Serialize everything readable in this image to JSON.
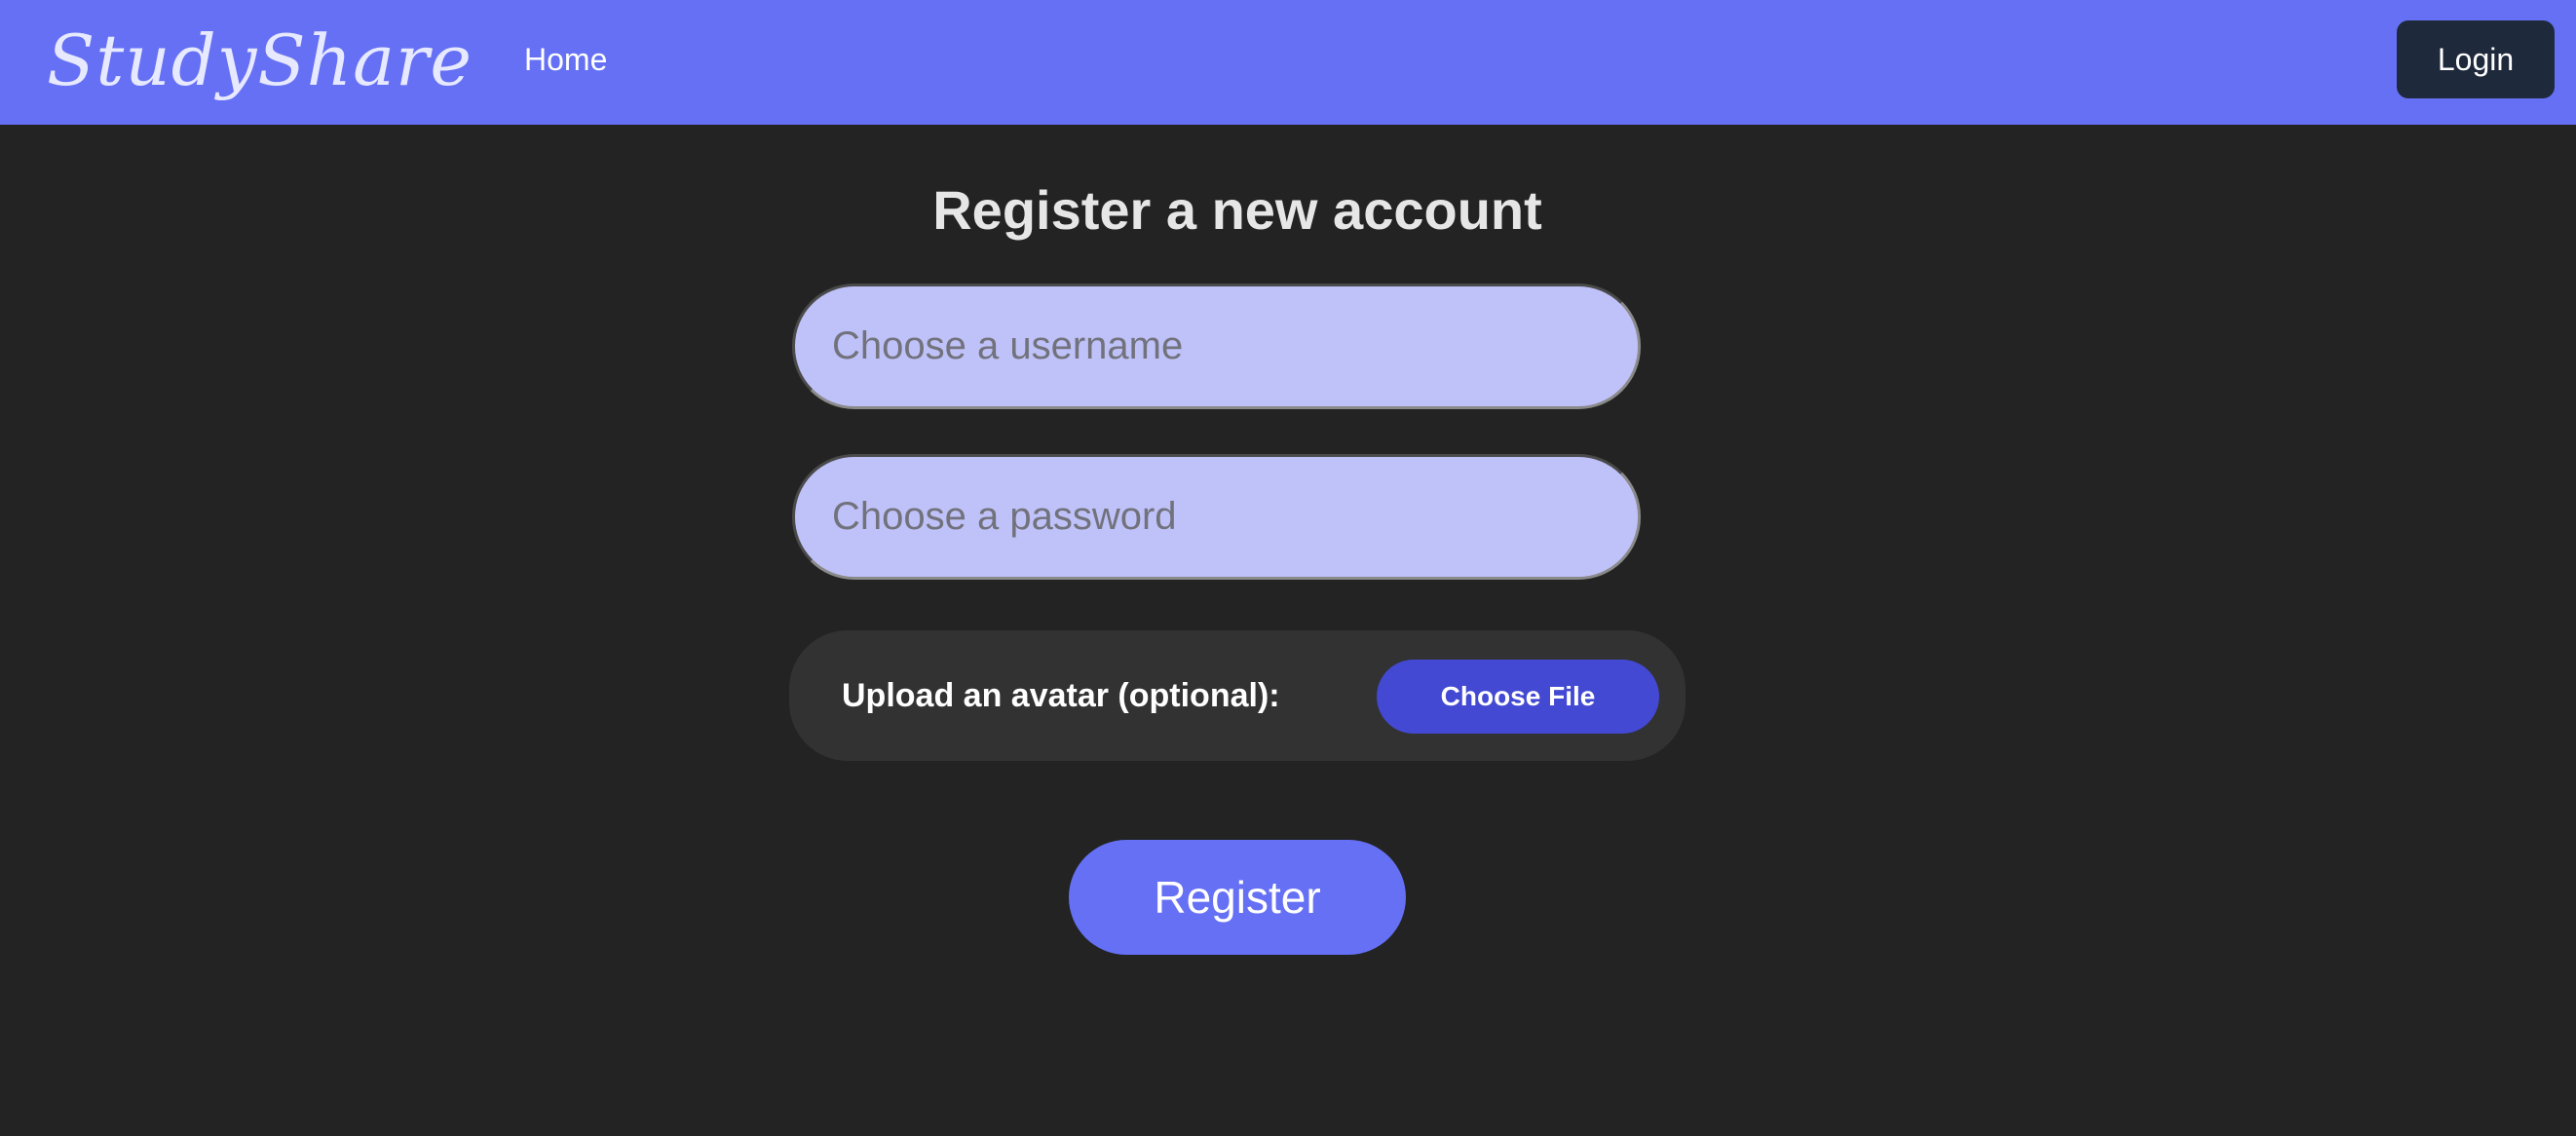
{
  "navbar": {
    "logo": "StudyShare",
    "home_label": "Home",
    "login_label": "Login"
  },
  "form": {
    "title": "Register a new account",
    "username": {
      "placeholder": "Choose a username",
      "value": ""
    },
    "password": {
      "placeholder": "Choose a password",
      "value": ""
    },
    "avatar": {
      "label": "Upload an avatar (optional):",
      "button_label": "Choose File"
    },
    "submit_label": "Register"
  },
  "colors": {
    "navbar_bg": "#6570f5",
    "page_bg": "#232323",
    "input_bg": "#bfc2f9",
    "login_button_bg": "#1e293b",
    "choose_file_bg": "#4349d2",
    "register_button_bg": "#6570f5",
    "upload_box_bg": "#323232"
  }
}
